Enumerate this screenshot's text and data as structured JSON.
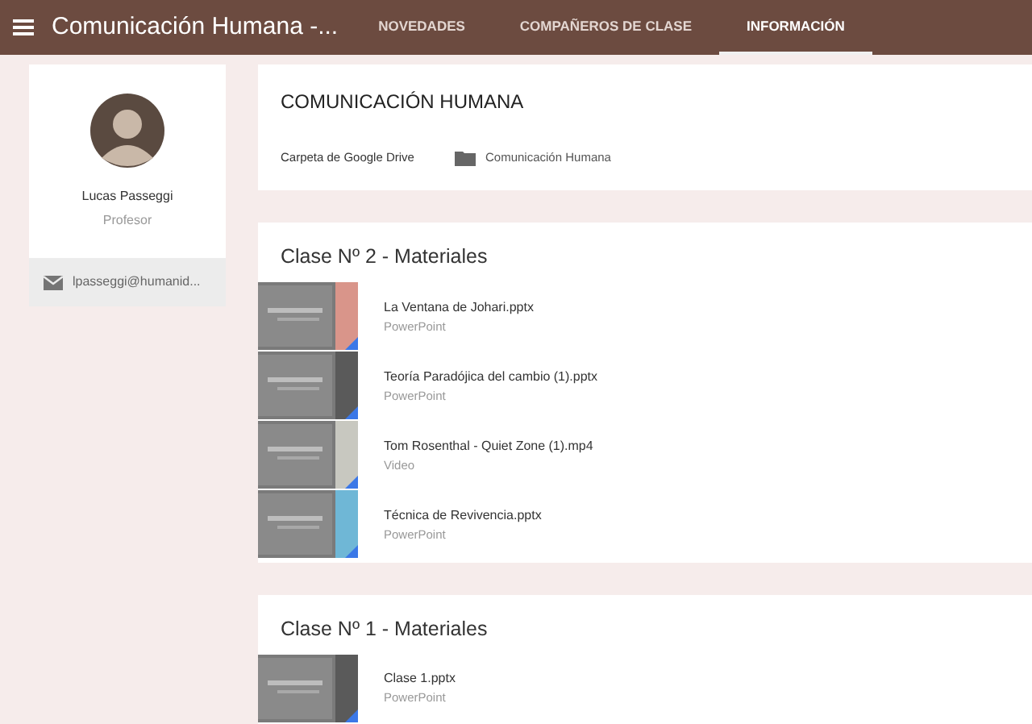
{
  "header": {
    "title": "Comunicación Humana -...",
    "tabs": [
      {
        "label": "NOVEDADES",
        "selected": false
      },
      {
        "label": "COMPAÑEROS DE CLASE",
        "selected": false
      },
      {
        "label": "INFORMACIÓN",
        "selected": true
      }
    ]
  },
  "teacher": {
    "name": "Lucas Passeggi",
    "role": "Profesor",
    "email": "lpasseggi@humanid..."
  },
  "course": {
    "title": "COMUNICACIÓN HUMANA",
    "drive_label": "Carpeta de Google Drive",
    "folder": "Comunicación Humana"
  },
  "sections": [
    {
      "title": "Clase Nº 2 - Materiales",
      "files": [
        {
          "name": "La Ventana de Johari.pptx",
          "type": "PowerPoint",
          "color": "#d9958a"
        },
        {
          "name": "Teoría Paradójica del cambio (1).pptx",
          "type": "PowerPoint",
          "color": "#5a5a5a"
        },
        {
          "name": "Tom Rosenthal - Quiet Zone (1).mp4",
          "type": "Video",
          "color": "#c8c8c0"
        },
        {
          "name": "Técnica de Revivencia.pptx",
          "type": "PowerPoint",
          "color": "#6fb7d6"
        }
      ]
    },
    {
      "title": "Clase Nº 1 - Materiales",
      "files": [
        {
          "name": "Clase 1.pptx",
          "type": "PowerPoint",
          "color": "#5a5a5a"
        }
      ]
    }
  ]
}
